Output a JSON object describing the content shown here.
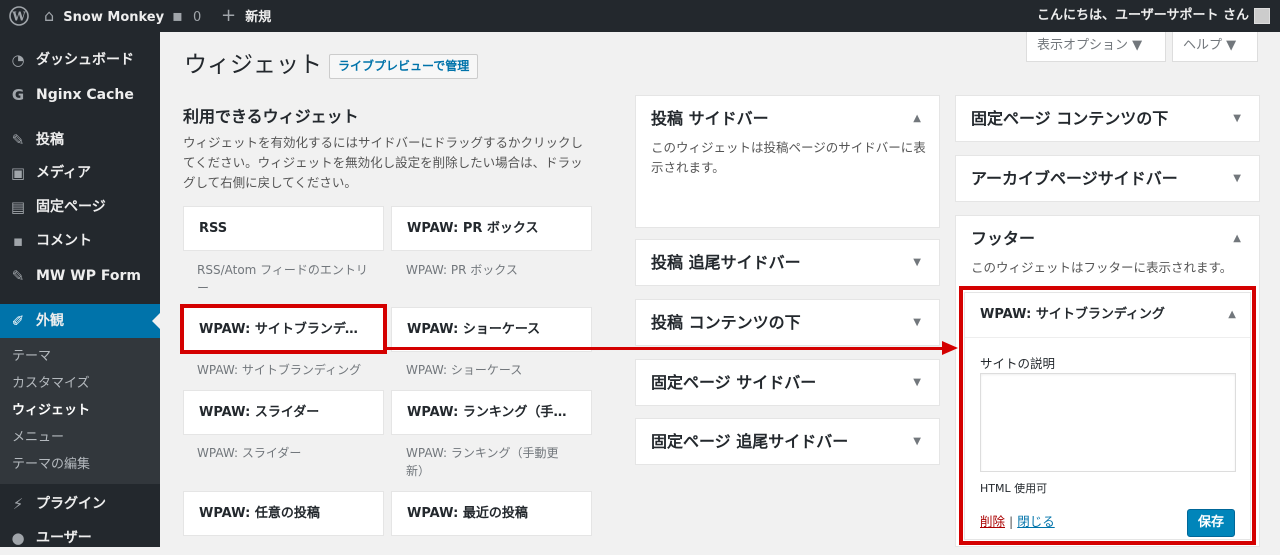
{
  "adminbar": {
    "site_name": "Snow Monkey",
    "comments_count": "0",
    "new_label": "新規",
    "greeting": "こんにちは、ユーザーサポート さん"
  },
  "sidebar": {
    "items": [
      {
        "label": "ダッシュボード",
        "icon": "dashboard-icon"
      },
      {
        "label": "Nginx Cache",
        "icon": "nginx-cache-icon"
      },
      {
        "label": "投稿",
        "icon": "pin-icon"
      },
      {
        "label": "メディア",
        "icon": "media-icon"
      },
      {
        "label": "固定ページ",
        "icon": "page-icon"
      },
      {
        "label": "コメント",
        "icon": "comment-icon"
      },
      {
        "label": "MW WP Form",
        "icon": "pin-icon"
      },
      {
        "label": "外観",
        "icon": "brush-icon"
      },
      {
        "label": "プラグイン",
        "icon": "plugin-icon"
      },
      {
        "label": "ユーザー",
        "icon": "user-icon"
      }
    ],
    "submenu": [
      "テーマ",
      "カスタマイズ",
      "ウィジェット",
      "メニュー",
      "テーマの編集"
    ]
  },
  "screen_options": "表示オプション ▼",
  "help": "ヘルプ ▼",
  "page": {
    "title": "ウィジェット",
    "live_preview_button": "ライブプレビューで管理"
  },
  "available": {
    "heading": "利用できるウィジェット",
    "description": "ウィジェットを有効化するにはサイドバーにドラッグするかクリックしてください。ウィジェットを無効化し設定を削除したい場合は、ドラッグして右側に戻してください。",
    "widgets": [
      {
        "title": "RSS",
        "desc": "RSS/Atom フィードのエントリー"
      },
      {
        "title": "WPAW: PR ボックス",
        "desc": "WPAW: PR ボックス"
      },
      {
        "title": "WPAW: サイトブランディング",
        "desc": "WPAW: サイトブランディング"
      },
      {
        "title": "WPAW: ショーケース",
        "desc": "WPAW: ショーケース"
      },
      {
        "title": "WPAW: スライダー",
        "desc": "WPAW: スライダー"
      },
      {
        "title": "WPAW: ランキング（手動更新）",
        "desc": "WPAW: ランキング（手動更新）"
      },
      {
        "title": "WPAW: 任意の投稿",
        "desc": ""
      },
      {
        "title": "WPAW: 最近の投稿",
        "desc": ""
      }
    ]
  },
  "sidebars_col1": [
    {
      "title": "投稿 サイドバー",
      "desc": "このウィジェットは投稿ページのサイドバーに表示されます。",
      "toggle": "▲"
    },
    {
      "title": "投稿 追尾サイドバー",
      "toggle": "▼"
    },
    {
      "title": "投稿 コンテンツの下",
      "toggle": "▼"
    },
    {
      "title": "固定ページ サイドバー",
      "toggle": "▼"
    },
    {
      "title": "固定ページ 追尾サイドバー",
      "toggle": "▼"
    }
  ],
  "sidebars_col2": [
    {
      "title": "固定ページ コンテンツの下",
      "toggle": "▼"
    },
    {
      "title": "アーカイブページサイドバー",
      "toggle": "▼"
    },
    {
      "title": "フッター",
      "desc": "このウィジェットはフッターに表示されます。",
      "toggle": "▲"
    }
  ],
  "open_widget": {
    "title": "WPAW: サイトブランディング",
    "toggle": "▲",
    "field_label": "サイトの説明",
    "field_value": "",
    "help": "HTML 使用可",
    "delete_link": "削除",
    "separator": "|",
    "close_link": "閉じる",
    "save_button": "保存"
  },
  "colors": {
    "adminbar_bg": "#23282d",
    "menu_current": "#0073aa",
    "highlight": "#d40000",
    "primary_button": "#0085ba"
  }
}
